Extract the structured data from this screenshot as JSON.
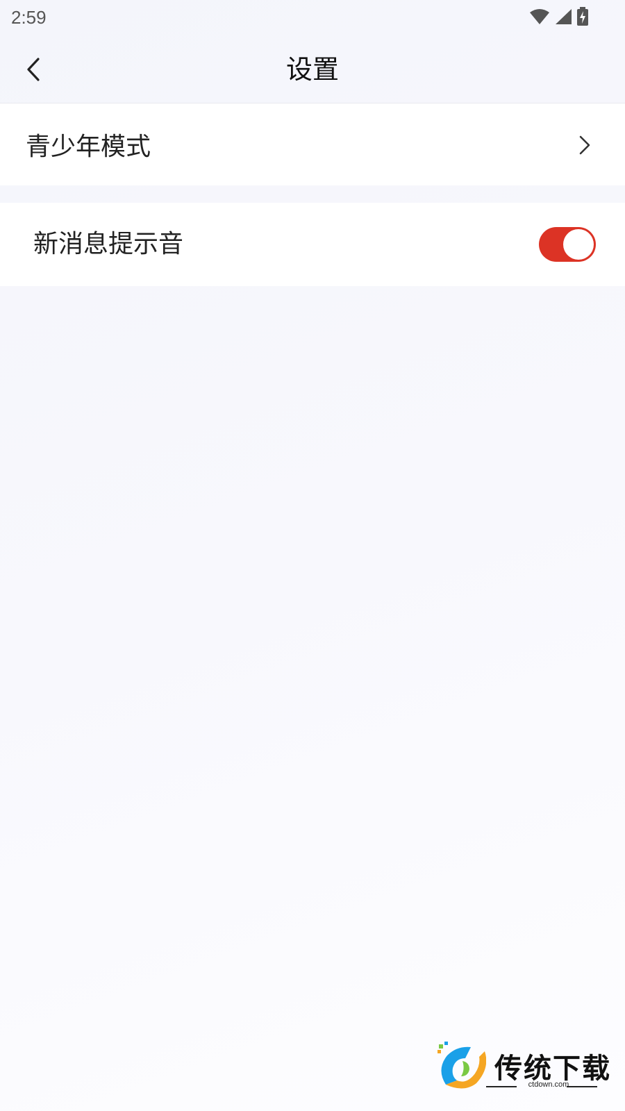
{
  "status_bar": {
    "time": "2:59",
    "icons": [
      "wifi-icon",
      "signal-icon",
      "battery-charging-icon"
    ]
  },
  "header": {
    "title": "设置",
    "back_icon": "chevron-left-icon"
  },
  "settings": [
    {
      "label": "青少年模式",
      "control": "chevron-right-icon"
    },
    {
      "label": "新消息提示音",
      "control": "toggle",
      "enabled": true
    }
  ],
  "colors": {
    "toggle_on": "#dc3325",
    "background": "#f6f7fc"
  },
  "watermark": {
    "text": "传统下载",
    "url": "ctdown.com"
  }
}
